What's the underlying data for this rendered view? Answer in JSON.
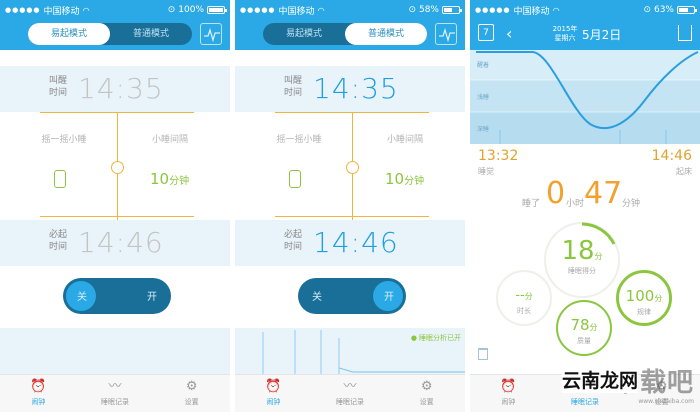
{
  "status": {
    "carrier": "中国移动",
    "phones": [
      {
        "battery": "100%",
        "battery_fill": 1.0
      },
      {
        "battery": "58%",
        "battery_fill": 0.58
      },
      {
        "battery": "63%",
        "battery_fill": 0.63
      }
    ]
  },
  "mode_switch": {
    "easy": "易起模式",
    "normal": "普通模式"
  },
  "alarm": {
    "wake_label": "叫醒时间",
    "wake_time": "14:35",
    "must_label": "必起时间",
    "must_time": "14:46",
    "shake_label": "摇一摇小睡",
    "nap_label": "小睡间隔",
    "nap_value": "10",
    "nap_unit": "分钟"
  },
  "toggle": {
    "off": "关",
    "on": "开"
  },
  "chart_legend": "睡眠分析已开",
  "tabs": {
    "alarm": "闹钟",
    "record": "睡眠记录",
    "settings": "设置"
  },
  "report": {
    "cal_day": "7",
    "year": "2015年",
    "weekday": "星期六",
    "date": "5月2日",
    "levels": [
      "醒着",
      "浅睡",
      "深睡"
    ],
    "sleep_time": "13:32",
    "sleep_label": "睡觉",
    "wake_time": "14:46",
    "wake_label": "起床",
    "duration_prefix": "睡了",
    "hours": "0",
    "hours_unit": "小时",
    "minutes": "47",
    "minutes_unit": "分钟",
    "score": "18",
    "score_unit": "分",
    "score_label": "睡眠得分",
    "len_score": "--",
    "len_unit": "分",
    "len_label": "时长",
    "deep_score": "78",
    "deep_unit": "分",
    "deep_label": "质量",
    "regular_score": "100",
    "regular_unit": "分",
    "regular_label": "规律",
    "tab_record_label": "睡眠记录"
  },
  "watermark": {
    "text1": "下载吧",
    "text2": "云南龙网",
    "url": "www.xiazaiba.com"
  },
  "colors": {
    "accent": "#2aa9e6",
    "orange": "#f0b53d",
    "green": "#8cc63f"
  }
}
